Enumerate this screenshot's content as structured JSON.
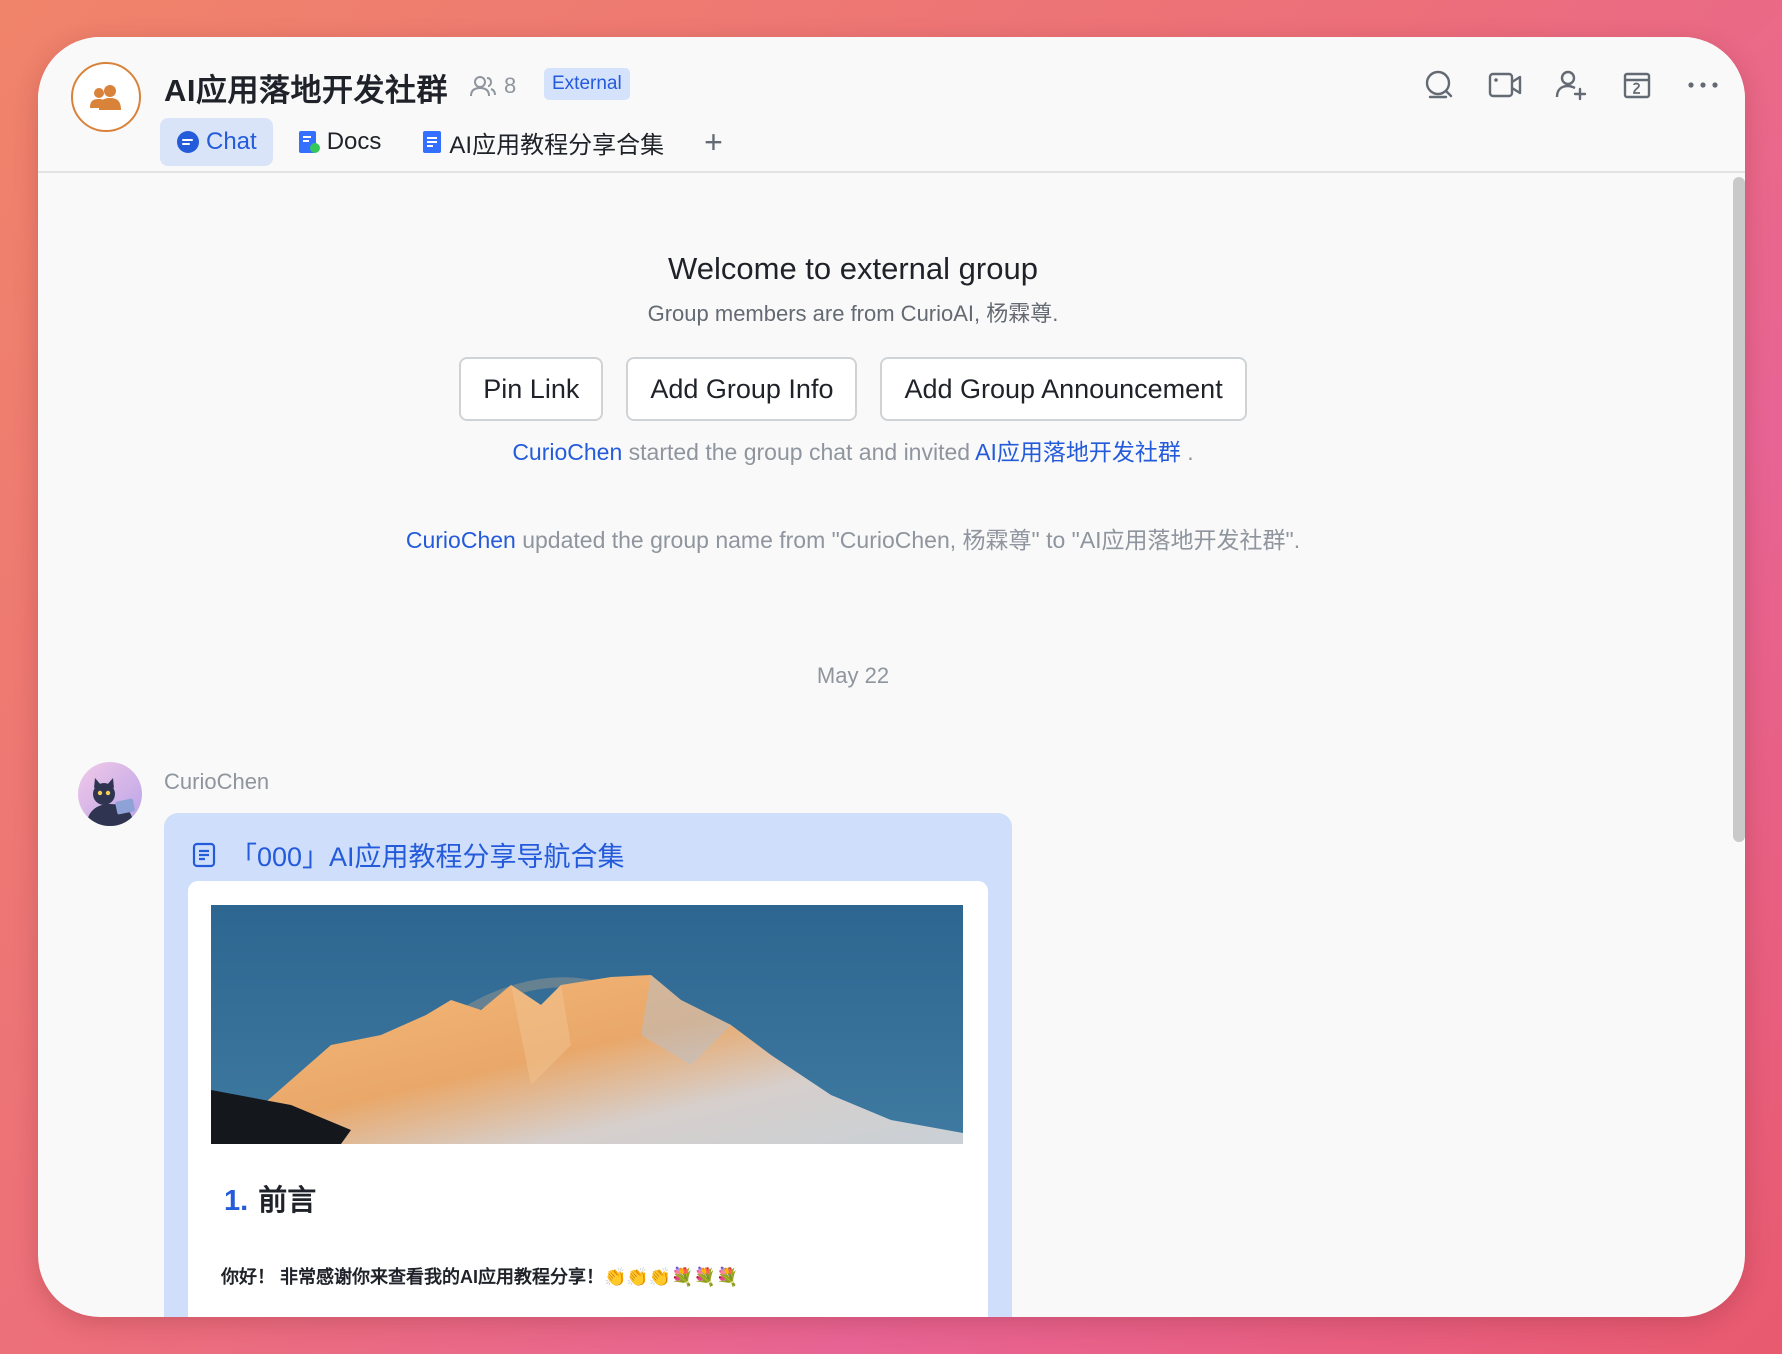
{
  "header": {
    "title": "AI应用落地开发社群",
    "member_count": "8",
    "badge": "External",
    "icons": [
      "search-icon",
      "video-call-icon",
      "add-member-icon",
      "calendar-icon",
      "more-icon"
    ]
  },
  "tabs": [
    {
      "label": "Chat",
      "icon": "chat-bubble-icon"
    },
    {
      "label": "Docs",
      "icon": "docs-icon"
    },
    {
      "label": "AI应用教程分享合集",
      "icon": "document-icon"
    },
    {
      "label": "+",
      "icon": "add-tab-icon"
    }
  ],
  "welcome": {
    "title": "Welcome to external group",
    "subtitle": "Group members are from CurioAI, 杨霖尊."
  },
  "buttons": {
    "pin_link": "Pin Link",
    "add_group_info": "Add Group Info",
    "add_group_announcement": "Add Group Announcement"
  },
  "system_messages": [
    {
      "actor": "CurioChen",
      "text": " started the group chat and invited ",
      "target": "AI应用落地开发社群",
      "end": " ."
    },
    {
      "actor": "CurioChen",
      "text": " updated the group name from \"CurioChen, 杨霖尊\" to \"AI应用落地开发社群\"."
    }
  ],
  "date_separator": "May 22",
  "message": {
    "sender": "CurioChen",
    "doc_title": "「000」AI应用教程分享导航合集",
    "section_number": "1.",
    "section_title": "前言",
    "body": "你好！ 非常感谢你来查看我的AI应用教程分享！👏👏👏💐💐💐"
  },
  "colors": {
    "accent": "#245bdb",
    "tab_active_bg": "#d9e4f9",
    "card_bg": "#cfdffb",
    "avatar_ring": "#d9823a"
  }
}
